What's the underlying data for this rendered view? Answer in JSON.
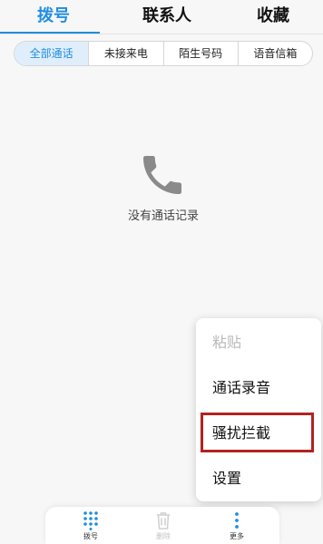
{
  "tabs": {
    "dial": "拨号",
    "contacts": "联系人",
    "favorites": "收藏"
  },
  "filters": {
    "all_calls": "全部通话",
    "missed_calls": "未接来电",
    "unknown_numbers": "陌生号码",
    "voicemail": "语音信箱"
  },
  "empty_state": {
    "message": "没有通话记录",
    "icon": "phone-icon"
  },
  "menu": {
    "paste": "粘贴",
    "call_recording": "通话录音",
    "harassment_block": "骚扰拦截",
    "settings": "设置"
  },
  "bottom_bar": {
    "dial_label": "拨号",
    "delete_label": "删除",
    "more_label": "更多"
  },
  "colors": {
    "accent": "#1f8ee0",
    "highlight_border": "#b22222"
  }
}
